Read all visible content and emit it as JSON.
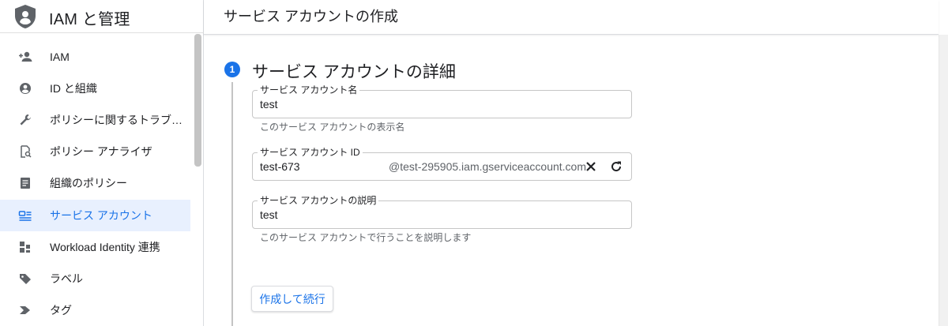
{
  "sidebar": {
    "title": "IAM と管理",
    "items": [
      {
        "label": "IAM",
        "icon": "person-add-icon"
      },
      {
        "label": "ID と組織",
        "icon": "account-circle-icon"
      },
      {
        "label": "ポリシーに関するトラブ…",
        "icon": "wrench-icon"
      },
      {
        "label": "ポリシー アナライザ",
        "icon": "policy-analyzer-icon"
      },
      {
        "label": "組織のポリシー",
        "icon": "document-icon"
      },
      {
        "label": "サービス アカウント",
        "icon": "service-account-icon",
        "active": true
      },
      {
        "label": "Workload Identity 連携",
        "icon": "workload-identity-icon"
      },
      {
        "label": "ラベル",
        "icon": "label-icon"
      },
      {
        "label": "タグ",
        "icon": "tag-icon"
      }
    ]
  },
  "header": {
    "title": "サービス アカウントの作成"
  },
  "step": {
    "number": "1",
    "title": "サービス アカウントの詳細"
  },
  "form": {
    "name": {
      "label": "サービス アカウント名",
      "value": "test",
      "hint": "このサービス アカウントの表示名"
    },
    "id": {
      "label": "サービス アカウント ID",
      "value": "test-673",
      "suffix": "@test-295905.iam.gserviceaccount.com"
    },
    "description": {
      "label": "サービス アカウントの説明",
      "value": "test",
      "hint": "このサービス アカウントで行うことを説明します"
    },
    "submit_label": "作成して続行"
  },
  "colors": {
    "accent": "#1a73e8",
    "active_bg": "#e8f0fe",
    "border": "#c6c6c6"
  }
}
